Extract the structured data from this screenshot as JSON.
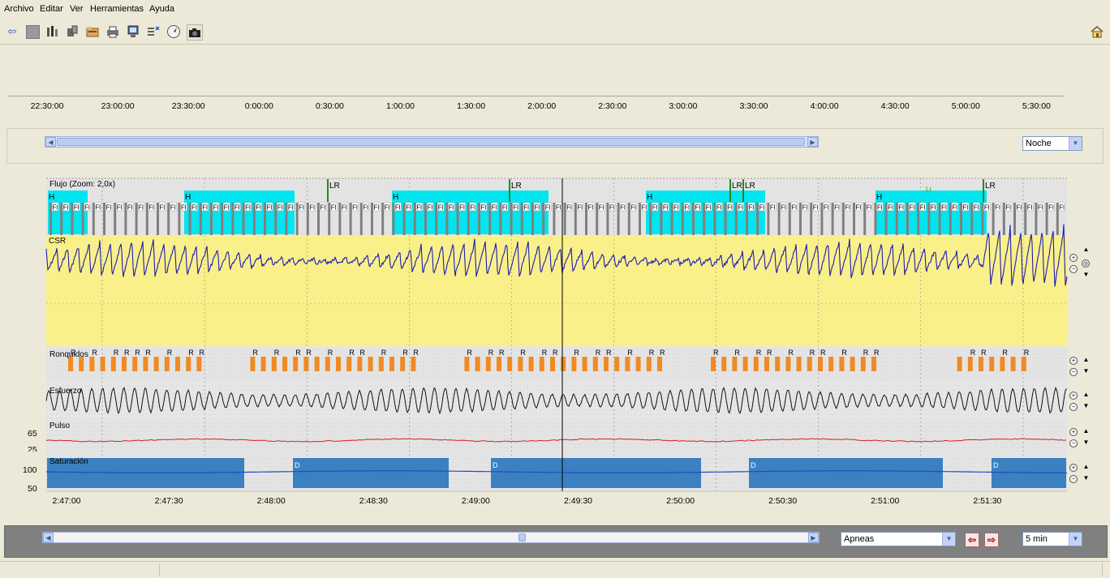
{
  "menu": [
    "Archivo",
    "Editar",
    "Ver",
    "Herramientas",
    "Ayuda"
  ],
  "toolbar": {
    "icons": [
      "back-arrow-icon",
      "stop-square-icon",
      "montage-icon",
      "tools-icon",
      "folder-icon",
      "print-icon",
      "monitor-icon",
      "channels-icon",
      "compass-icon",
      "camera-icon"
    ],
    "home_icon": "home-icon"
  },
  "ruler": {
    "labels": [
      "22:30:00",
      "23:00:00",
      "23:30:00",
      "0:00:00",
      "0:30:00",
      "1:00:00",
      "1:30:00",
      "2:00:00",
      "2:30:00",
      "3:00:00",
      "3:30:00",
      "4:00:00",
      "4:30:00",
      "5:00:00",
      "5:30:00"
    ]
  },
  "overview": {
    "view_select": "Noche"
  },
  "channels": {
    "flow_label": "Flujo (Zoom: 2,0x)",
    "csr_label": "CSR",
    "snore_label": "Ronquidos",
    "effort_label": "Esfuerzo",
    "pulse_label": "Pulso",
    "sat_label": "Saturación",
    "pulse_ytick": "65",
    "pulse_ytick2": "25",
    "sat_ytick_top": "100",
    "sat_ytick_bottom": "50",
    "event_lr": "LR",
    "event_h": "H",
    "event_fl": "Fl",
    "event_r": "R",
    "event_d": "D",
    "event_lr_small": "Lr"
  },
  "chart_data": {
    "type": "line",
    "x_ticks": [
      "2:47:00",
      "2:47:30",
      "2:48:00",
      "2:48:30",
      "2:49:00",
      "2:49:30",
      "2:50:00",
      "2:50:30",
      "2:51:00",
      "2:51:30"
    ],
    "colors": {
      "flow_trace": "#1c1cb0",
      "csr_fill": "#faf08a",
      "hypopnea": "#00e5ee",
      "flow_limitation": "#808080",
      "lr_marker": "#1e8c1e",
      "snore": "#f08a24",
      "pulse": "#d42020",
      "saturation_band": "#3b80c0",
      "saturation_line": "#1d4fbf",
      "cursor": "#000000"
    }
  },
  "bottom": {
    "event_select": "Apneas",
    "span_select": "5 min",
    "prev_icon": "prev-event-arrow-icon",
    "next_icon": "next-event-arrow-icon"
  }
}
